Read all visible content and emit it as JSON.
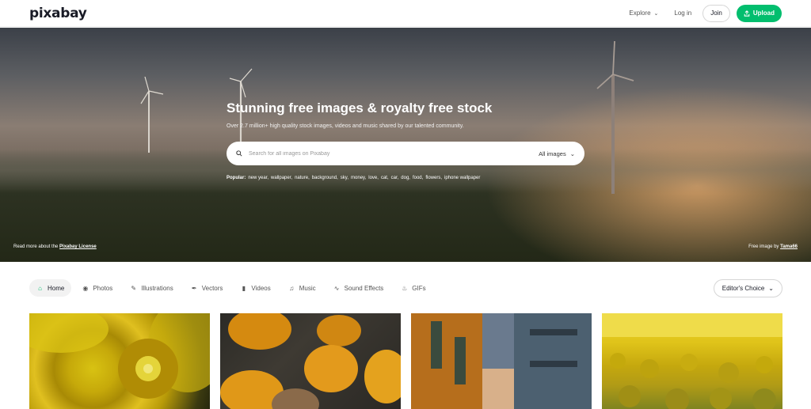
{
  "header": {
    "logo": "pixabay",
    "explore_label": "Explore",
    "login_label": "Log in",
    "join_label": "Join",
    "upload_label": "Upload"
  },
  "hero": {
    "title": "Stunning free images & royalty free stock",
    "subtitle": "Over 2.7 million+ high quality stock images, videos and music shared by our talented community.",
    "search_placeholder": "Search for all images on Pixabay",
    "search_type": "All images",
    "popular_label": "Popular:",
    "popular_tags": [
      "new year,",
      "wallpaper,",
      "nature,",
      "background,",
      "sky,",
      "money,",
      "love,",
      "cat,",
      "car,",
      "dog,",
      "food,",
      "flowers,",
      "iphone wallpaper"
    ],
    "license_text": "Read more about the",
    "license_link": "Pixabay License",
    "credit_text": "Free image by",
    "credit_link": "Tama66"
  },
  "categories": [
    {
      "label": "Home",
      "icon": "home-icon",
      "active": true
    },
    {
      "label": "Photos",
      "icon": "camera-icon",
      "active": false
    },
    {
      "label": "Illustrations",
      "icon": "brush-icon",
      "active": false
    },
    {
      "label": "Vectors",
      "icon": "pen-nib-icon",
      "active": false
    },
    {
      "label": "Videos",
      "icon": "video-icon",
      "active": false
    },
    {
      "label": "Music",
      "icon": "music-note-icon",
      "active": false
    },
    {
      "label": "Sound Effects",
      "icon": "waveform-icon",
      "active": false
    },
    {
      "label": "GIFs",
      "icon": "flame-icon",
      "active": false
    }
  ],
  "sort": {
    "label": "Editor's Choice"
  },
  "colors": {
    "accent": "#02be6e",
    "text": "#191b26"
  }
}
